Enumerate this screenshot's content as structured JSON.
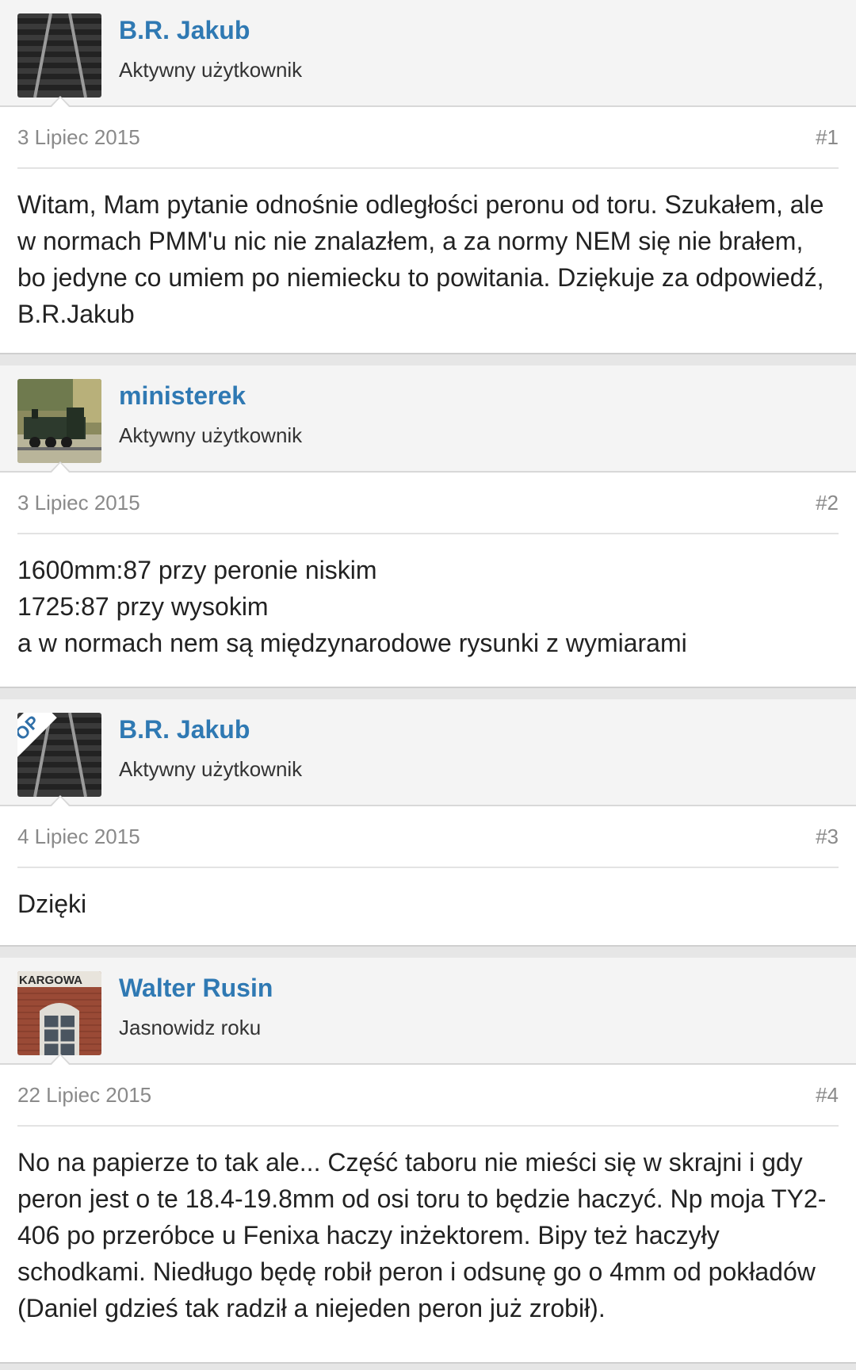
{
  "posts": [
    {
      "username": "B.R. Jakub",
      "user_title": "Aktywny użytkownik",
      "date": "3 Lipiec 2015",
      "number": "#1",
      "body": "Witam, Mam pytanie odnośnie odległości peronu od toru. Szukałem, ale\nw normach PMM'u nic nie znalazłem, a za normy NEM się nie brałem,\nbo jedyne co umiem po niemiecku to powitania. Dziękuje za odpowiedź,\nB.R.Jakub",
      "avatar_icon": "railway-track-avatar"
    },
    {
      "username": "ministerek",
      "user_title": "Aktywny użytkownik",
      "date": "3 Lipiec 2015",
      "number": "#2",
      "body": "1600mm:87 przy peronie niskim\n1725:87 przy wysokim\na w normach nem są międzynarodowe rysunki z wymiarami",
      "avatar_icon": "model-locomotive-avatar"
    },
    {
      "username": "B.R. Jakub",
      "user_title": "Aktywny użytkownik",
      "date": "4 Lipiec 2015",
      "number": "#3",
      "body": "Dzięki",
      "op_badge": "OP",
      "avatar_icon": "railway-track-avatar"
    },
    {
      "username": "Walter Rusin",
      "user_title": "Jasnowidz roku",
      "date": "22 Lipiec 2015",
      "number": "#4",
      "body": "No na papierze to tak ale... Część taboru nie mieści się w skrajni i gdy\nperon jest o te 18.4-19.8mm od osi toru to będzie haczyć. Np moja TY2-\n406 po przeróbce u Fenixa haczy inżektorem. Bipy też haczyły\nschodkami. Niedługo będę robił peron i odsunę go o 4mm od pokładów\n(Daniel gdzieś tak radził a niejeden peron już zrobił).",
      "avatar_icon": "station-building-avatar",
      "avatar_sign_text": "KARGOWA"
    }
  ],
  "colors": {
    "username": "#2f79b3",
    "header_bg": "#f4f4f4",
    "meta_text": "#8a8a8a",
    "body_text": "#222222"
  }
}
